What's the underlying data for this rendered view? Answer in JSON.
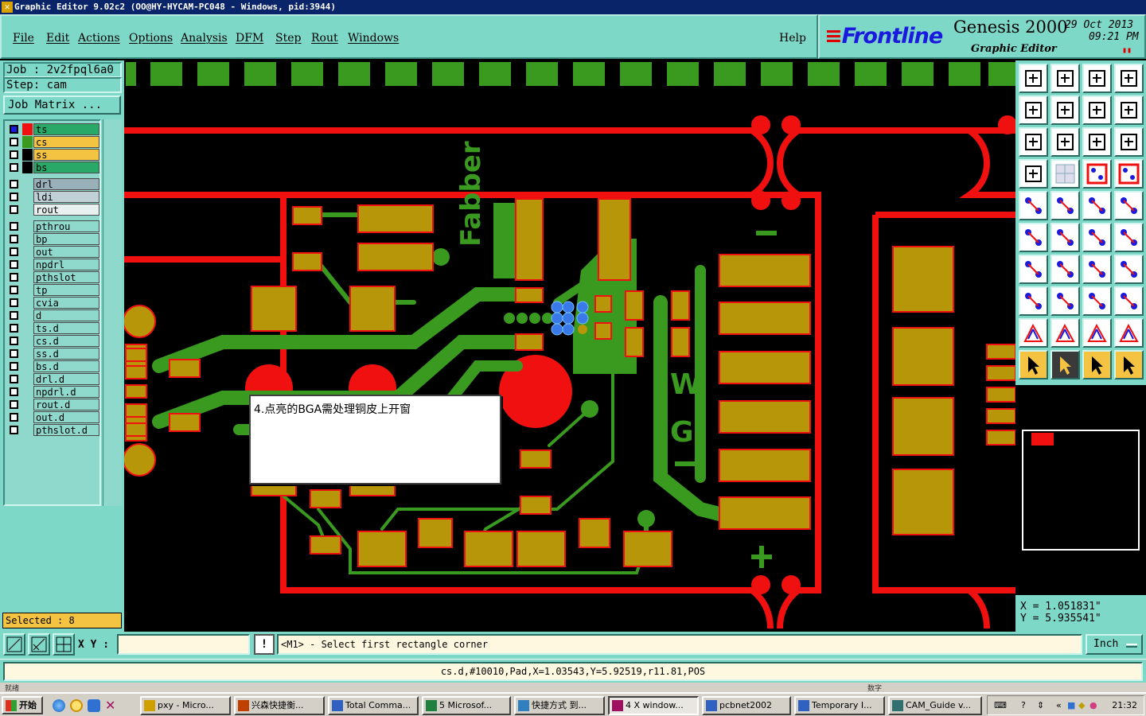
{
  "titlebar": {
    "title": "Graphic Editor 9.02c2 (OO@HY-HYCAM-PC048 - Windows, pid:3944)"
  },
  "menu": {
    "items": [
      "File",
      "Edit",
      "Actions",
      "Options",
      "Analysis",
      "DFM",
      "Step",
      "Rout",
      "Windows"
    ],
    "help": "Help"
  },
  "brand": {
    "logo": "Frontline",
    "product": "Genesis 2000",
    "subtitle": "Graphic Editor",
    "date": "29 Oct 2013",
    "time": "09:21 PM"
  },
  "job": {
    "job_label": "Job : 2v2fpql6a0",
    "step_label": "Step: cam",
    "matrix_button": "Job Matrix ..."
  },
  "layers": [
    {
      "name": "ts",
      "color": "#2aa868"
    },
    {
      "name": "cs",
      "color": "#f5c342"
    },
    {
      "name": "ss",
      "color": "#f5c342"
    },
    {
      "name": "bs",
      "color": "#2aa868"
    },
    {
      "name": "drl",
      "color": "#9ab0b8"
    },
    {
      "name": "ldi",
      "color": "#c0d0d6"
    },
    {
      "name": "rout",
      "color": "#e8f0f0"
    },
    {
      "name": "pthrou",
      "color": "#8fd8cc"
    },
    {
      "name": "bp",
      "color": "#8fd8cc"
    },
    {
      "name": "out",
      "color": "#8fd8cc"
    },
    {
      "name": "npdrl",
      "color": "#8fd8cc"
    },
    {
      "name": "pthslot",
      "color": "#8fd8cc"
    },
    {
      "name": "tp",
      "color": "#8fd8cc"
    },
    {
      "name": "cvia",
      "color": "#8fd8cc"
    },
    {
      "name": "d",
      "color": "#8fd8cc"
    },
    {
      "name": "ts.d",
      "color": "#8fd8cc"
    },
    {
      "name": "cs.d",
      "color": "#8fd8cc"
    },
    {
      "name": "ss.d",
      "color": "#8fd8cc"
    },
    {
      "name": "bs.d",
      "color": "#8fd8cc"
    },
    {
      "name": "drl.d",
      "color": "#8fd8cc"
    },
    {
      "name": "npdrl.d",
      "color": "#8fd8cc"
    },
    {
      "name": "rout.d",
      "color": "#8fd8cc"
    },
    {
      "name": "out.d",
      "color": "#8fd8cc"
    },
    {
      "name": "pthslot.d",
      "color": "#8fd8cc"
    }
  ],
  "selection": {
    "label": "Selected : 8"
  },
  "canvas": {
    "annotation": "4.点亮的BGA需处理铜皮上开窗",
    "silk_text_1": "Fabber",
    "silk_text_2": "W",
    "silk_text_3": "G"
  },
  "coords": {
    "x": "X = 1.051831\"",
    "y": "Y = 5.935541\""
  },
  "command": {
    "xy_label": "X Y :",
    "xy_value": "",
    "info_button": "!",
    "prompt": "<M1> - Select first rectangle corner",
    "units": "Inch"
  },
  "status": {
    "text": "cs.d,#10010,Pad,X=1.03543,Y=5.92519,r11.81,POS"
  },
  "winstrip": {
    "left": "就绪",
    "right": "数字"
  },
  "taskbar": {
    "start": "开始",
    "tasks": [
      "pxy - Micro...",
      "兴森快捷衡...",
      "Total Comma...",
      "5 Microsof...",
      "快捷方式 到...",
      "4 X window...",
      "pcbnet2002",
      "Temporary I...",
      "CAM_Guide v..."
    ],
    "clock": "21:32"
  },
  "colors": {
    "copper_pad": "#b8960a",
    "trace": "#3a9a20",
    "outline": "#f01010",
    "panel": "#7ed8c8"
  }
}
